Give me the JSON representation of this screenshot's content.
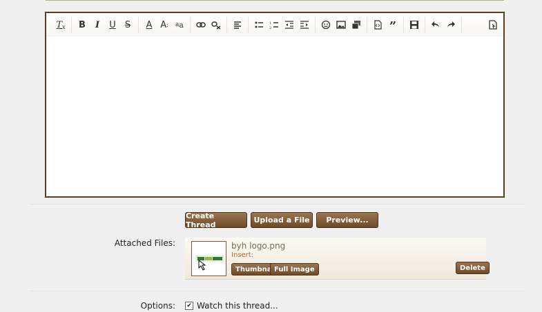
{
  "toolbar": {
    "groups": [
      {
        "buttons": [
          {
            "name": "remove-format-icon",
            "glyph": "Tx"
          }
        ]
      },
      {
        "buttons": [
          {
            "name": "bold-icon",
            "glyph": "B"
          },
          {
            "name": "italic-icon",
            "glyph": "I"
          },
          {
            "name": "underline-icon",
            "glyph": "U"
          },
          {
            "name": "strikethrough-icon",
            "glyph": "S"
          }
        ]
      },
      {
        "buttons": [
          {
            "name": "font-color-icon",
            "glyph": "A"
          },
          {
            "name": "font-size-icon",
            "glyph": "A"
          },
          {
            "name": "font-family-icon",
            "glyph": "a"
          }
        ]
      },
      {
        "buttons": [
          {
            "name": "link-icon",
            "glyph": ""
          },
          {
            "name": "unlink-icon",
            "glyph": ""
          }
        ]
      },
      {
        "buttons": [
          {
            "name": "align-icon",
            "glyph": ""
          }
        ]
      },
      {
        "buttons": [
          {
            "name": "bullet-list-icon",
            "glyph": ""
          },
          {
            "name": "number-list-icon",
            "glyph": ""
          },
          {
            "name": "outdent-icon",
            "glyph": ""
          },
          {
            "name": "indent-icon",
            "glyph": ""
          }
        ]
      },
      {
        "buttons": [
          {
            "name": "smilie-icon",
            "glyph": "☺"
          },
          {
            "name": "image-icon",
            "glyph": ""
          },
          {
            "name": "media-icon",
            "glyph": ""
          }
        ]
      },
      {
        "buttons": [
          {
            "name": "code-icon",
            "glyph": ""
          },
          {
            "name": "quote-icon",
            "glyph": "”"
          }
        ]
      },
      {
        "buttons": [
          {
            "name": "save-draft-icon",
            "glyph": ""
          }
        ]
      },
      {
        "buttons": [
          {
            "name": "undo-icon",
            "glyph": ""
          },
          {
            "name": "redo-icon",
            "glyph": ""
          }
        ]
      },
      {
        "buttons": [
          {
            "name": "toggle-bbcode-icon",
            "glyph": ""
          }
        ]
      }
    ]
  },
  "actions": {
    "create_label": "Create Thread",
    "upload_label": "Upload a File",
    "preview_label": "Preview..."
  },
  "attachments": {
    "label": "Attached Files:",
    "file_name": "byh logo.png",
    "insert_label": "Insert:",
    "thumbnail_label": "Thumbnail",
    "full_label": "Full Image",
    "delete_label": "Delete"
  },
  "options": {
    "label": "Options:",
    "watch_label": "Watch this thread...",
    "watch_checked": true
  },
  "colors": {
    "button_brown": "#7a5532",
    "editor_border": "#5a3c1e"
  }
}
